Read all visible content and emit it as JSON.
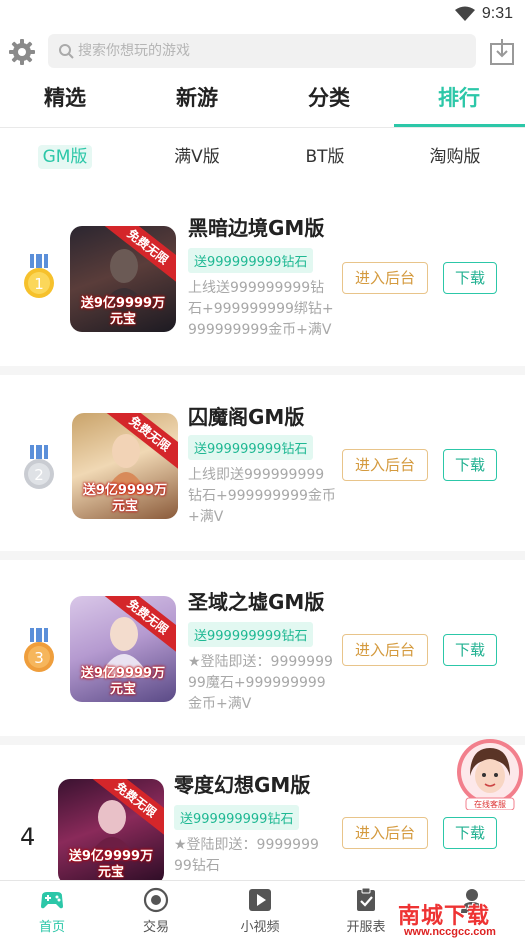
{
  "status_bar": {
    "time": "9:31"
  },
  "search": {
    "placeholder": "搜索你想玩的游戏"
  },
  "tabs": [
    {
      "label": "精选",
      "active": false
    },
    {
      "label": "新游",
      "active": false
    },
    {
      "label": "分类",
      "active": false
    },
    {
      "label": "排行",
      "active": true
    }
  ],
  "subtabs": [
    {
      "label": "GM版",
      "active": true
    },
    {
      "label": "满V版",
      "active": false
    },
    {
      "label": "BT版",
      "active": false
    },
    {
      "label": "淘购版",
      "active": false
    }
  ],
  "games": [
    {
      "rank": "1",
      "rank_icon": "gold-medal-icon",
      "title": "黑暗边境GM版",
      "tag": "送999999999钻石",
      "desc": "上线送999999999钻石+999999999绑钻+999999999金币+满V",
      "thumb": {
        "ribbon": "免费无限",
        "promo_line1": "送9亿9999万",
        "promo_line2": "元宝"
      },
      "admin_label": "进入后台",
      "download_label": "下载"
    },
    {
      "rank": "2",
      "rank_icon": "silver-medal-icon",
      "title": "囚魔阁GM版",
      "tag": "送999999999钻石",
      "desc": "上线即送999999999钻石+999999999金币+满V",
      "thumb": {
        "ribbon": "免费无限",
        "promo_line1": "送9亿9999万",
        "promo_line2": "元宝"
      },
      "admin_label": "进入后台",
      "download_label": "下载"
    },
    {
      "rank": "3",
      "rank_icon": "bronze-medal-icon",
      "title": "圣域之墟GM版",
      "tag": "送999999999钻石",
      "desc": "★登陆即送：999999999魔石+999999999金币+满V",
      "thumb": {
        "ribbon": "免费无限",
        "promo_line1": "送9亿9999万",
        "promo_line2": "元宝"
      },
      "admin_label": "进入后台",
      "download_label": "下载"
    },
    {
      "rank": "4",
      "rank_icon": "",
      "title": "零度幻想GM版",
      "tag": "送999999999钻石",
      "desc": "★登陆即送：999999999钻石",
      "thumb": {
        "ribbon": "免费无限",
        "promo_line1": "送9亿9999万",
        "promo_line2": "元宝"
      },
      "admin_label": "进入后台",
      "download_label": "下载"
    }
  ],
  "service": {
    "label": "在线客服"
  },
  "bottom_nav": [
    {
      "label": "首页",
      "icon": "gamepad-icon",
      "active": true
    },
    {
      "label": "交易",
      "icon": "coin-icon",
      "active": false
    },
    {
      "label": "小视频",
      "icon": "play-icon",
      "active": false
    },
    {
      "label": "开服表",
      "icon": "clipboard-check-icon",
      "active": false
    },
    {
      "label": "",
      "icon": "user-icon",
      "active": false
    }
  ],
  "watermark": {
    "title": "南城下载",
    "url": "www.nccgcc.com"
  },
  "colors": {
    "accent": "#2cc7a8",
    "admin": "#d49a3e",
    "tag_bg": "#e2f8f1",
    "ribbon": "#d4262a"
  }
}
